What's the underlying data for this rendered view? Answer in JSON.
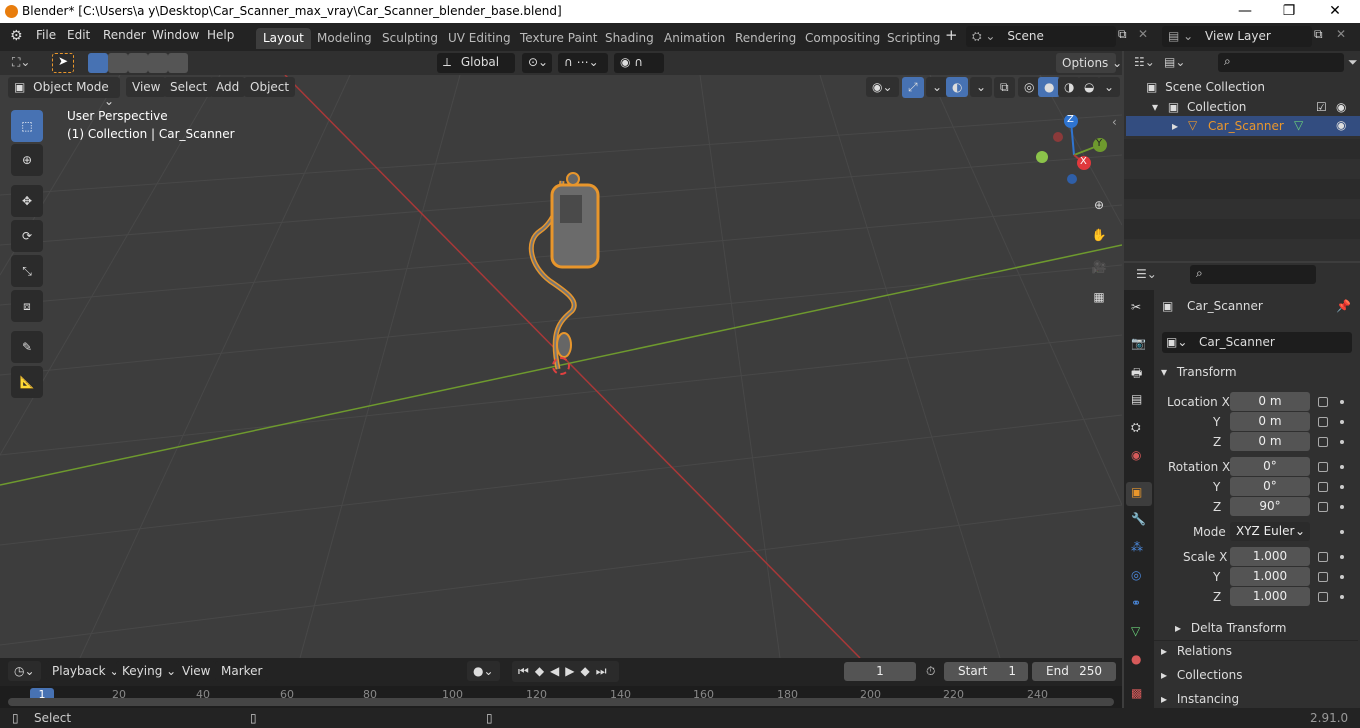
{
  "window": {
    "title": "Blender* [C:\\Users\\a y\\Desktop\\Car_Scanner_max_vray\\Car_Scanner_blender_base.blend]",
    "minimize": "—",
    "maximize": "❐",
    "close": "✕"
  },
  "menubar": {
    "items": [
      "File",
      "Edit",
      "Render",
      "Window",
      "Help"
    ]
  },
  "workspaces": [
    "Layout",
    "Modeling",
    "Sculpting",
    "UV Editing",
    "Texture Paint",
    "Shading",
    "Animation",
    "Rendering",
    "Compositing",
    "Scripting"
  ],
  "scene": {
    "label": "Scene"
  },
  "view_layer": {
    "label": "View Layer"
  },
  "toolbar": {
    "orientation": "Global",
    "options": "Options"
  },
  "viewport_header": {
    "mode": "Object Mode",
    "menus": [
      "View",
      "Select",
      "Add",
      "Object"
    ]
  },
  "viewport": {
    "perspective": "User Perspective",
    "collection_info": "(1) Collection | Car_Scanner",
    "gizmo": {
      "z": "Z",
      "y": "Y",
      "x": "X"
    }
  },
  "outliner": {
    "scene_collection": "Scene Collection",
    "collection": "Collection",
    "object": "Car_Scanner"
  },
  "properties": {
    "object_name": "Car_Scanner",
    "data_name": "Car_Scanner",
    "transform_label": "Transform",
    "location_label": "Location X",
    "location": [
      "0 m",
      "0 m",
      "0 m"
    ],
    "rotation_label": "Rotation X",
    "rotation": [
      "0°",
      "0°",
      "90°"
    ],
    "mode_label": "Mode",
    "mode_value": "XYZ Euler",
    "scale_label": "Scale X",
    "scale": [
      "1.000",
      "1.000",
      "1.000"
    ],
    "axis_y": "Y",
    "axis_z": "Z",
    "delta_transform": "Delta Transform",
    "relations": "Relations",
    "collections": "Collections",
    "instancing": "Instancing"
  },
  "timeline": {
    "menus": [
      "Playback",
      "Keying",
      "View",
      "Marker"
    ],
    "current_frame": "1",
    "start_label": "Start",
    "start": "1",
    "end_label": "End",
    "end": "250",
    "ruler": [
      "1",
      "20",
      "40",
      "60",
      "80",
      "100",
      "120",
      "140",
      "160",
      "180",
      "200",
      "220",
      "240"
    ]
  },
  "statusbar": {
    "select": "Select",
    "version": "2.91.0"
  },
  "colors": {
    "accent": "#4772b3",
    "selection_orange": "#e8962c",
    "x_axis": "#b33a3a",
    "y_axis": "#6e9a2e",
    "z_axis": "#2f74d0"
  }
}
